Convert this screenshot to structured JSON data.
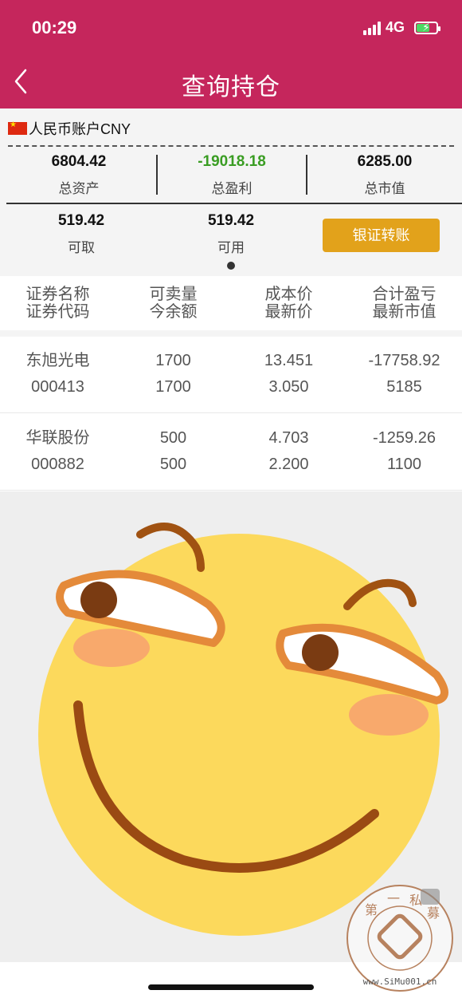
{
  "status_bar": {
    "time": "00:29",
    "network": "4G"
  },
  "nav": {
    "title": "查询持仓"
  },
  "account": {
    "label": "人民币账户CNY"
  },
  "summary": {
    "total_assets": {
      "value": "6804.42",
      "label": "总资产"
    },
    "total_profit": {
      "value": "-19018.18",
      "label": "总盈利"
    },
    "market_value": {
      "value": "6285.00",
      "label": "总市值"
    },
    "withdrawable": {
      "value": "519.42",
      "label": "可取"
    },
    "available": {
      "value": "519.42",
      "label": "可用"
    },
    "transfer_button": "银证转账"
  },
  "table": {
    "headers": [
      {
        "line1": "证券名称",
        "line2": "证券代码"
      },
      {
        "line1": "可卖量",
        "line2": "今余额"
      },
      {
        "line1": "成本价",
        "line2": "最新价"
      },
      {
        "line1": "合计盈亏",
        "line2": "最新市值"
      }
    ],
    "rows": [
      {
        "name": "东旭光电",
        "code": "000413",
        "sellable": "1700",
        "balance": "1700",
        "cost": "13.451",
        "latest": "3.050",
        "pnl": "-17758.92",
        "mv": "5185"
      },
      {
        "name": "华联股份",
        "code": "000882",
        "sellable": "500",
        "balance": "500",
        "cost": "4.703",
        "latest": "2.200",
        "pnl": "-1259.26",
        "mv": "1100"
      }
    ]
  },
  "watermark": {
    "chars": [
      "第",
      "一",
      "私",
      "募"
    ],
    "url": "www.SiMu001.cn"
  },
  "colors": {
    "header": "#c5265c",
    "button": "#e2a21b",
    "negative": "#3a9d23"
  },
  "icons": [
    "back-chevron-icon",
    "signal-icon",
    "battery-icon",
    "cn-flag-icon",
    "smirk-emoji"
  ]
}
